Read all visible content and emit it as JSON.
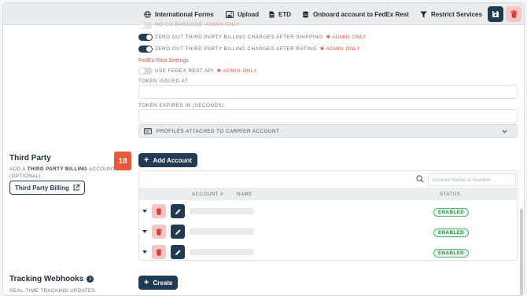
{
  "toolbar": {
    "international_forms": "International Forms",
    "upload": "Upload",
    "etd": "ETD",
    "onboard": "Onboard account to FedEx Rest",
    "restrict": "Restrict Services"
  },
  "settings": {
    "cut_off_row": "No CO Barcode",
    "admin_only": "ADMIN ONLY",
    "toggles": [
      {
        "label": "ZERO OUT THIRD PARTY BILLING CHARGES AFTER SHIPPING",
        "admin": "ADMIN ONLY",
        "state": "on"
      },
      {
        "label": "ZERO OUT THIRD PARTY BILLING CHARGES AFTER RATING",
        "admin": "ADMIN ONLY",
        "state": "on"
      }
    ],
    "fedex_rest_heading": "FedEx Rest Settings",
    "use_fedex_rest": {
      "label": "USE FEDEX REST API",
      "admin": "ADMIN ONLY",
      "state": "off"
    },
    "token_issued_label": "TOKEN ISSUED AT",
    "token_expires_label": "TOKEN EXPIRES IN (SECONDS)",
    "profiles_label": "PROFILES ATTACHED TO CARRIER ACCOUNT"
  },
  "third_party": {
    "title": "Third Party",
    "desc_prefix": "ADD A",
    "desc_bold": "THIRD PARTY BILLING",
    "desc_suffix": "ACCOUNT",
    "desc_optional": "(OPTIONAL)",
    "link_button": "Third Party Billing",
    "count": "18",
    "add_button": "Add Account",
    "search_placeholder": "Account Name or Number...",
    "columns": {
      "account": "ACCOUNT #",
      "name": "NAME",
      "status": "STATUS"
    },
    "rows": [
      {
        "status": "ENABLED"
      },
      {
        "status": "ENABLED"
      },
      {
        "status": "ENABLED"
      }
    ]
  },
  "webhooks": {
    "title": "Tracking Webhooks",
    "desc": "REAL-TIME TRACKING UPDATES",
    "create_button": "Create"
  },
  "colors": {
    "navy": "#213b52",
    "accent": "#e8583c",
    "enabled": "#2f8a4b"
  }
}
